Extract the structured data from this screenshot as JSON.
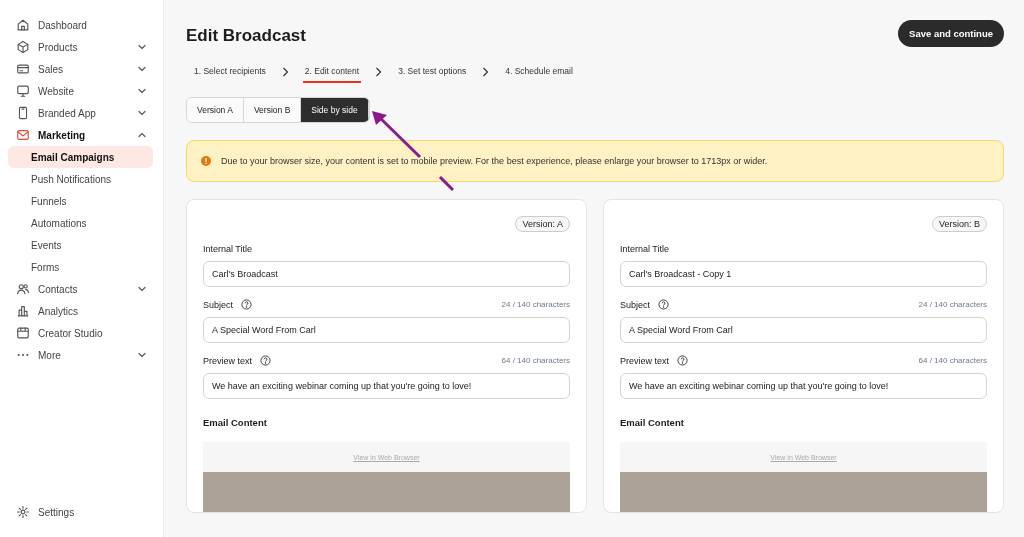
{
  "sidebar": {
    "items": [
      {
        "label": "Dashboard",
        "selected": false
      },
      {
        "label": "Products",
        "selected": false,
        "expanded": false
      },
      {
        "label": "Sales",
        "selected": false,
        "expanded": false
      },
      {
        "label": "Website",
        "selected": false,
        "expanded": false
      },
      {
        "label": "Branded App",
        "selected": false,
        "expanded": false
      },
      {
        "label": "Marketing",
        "selected": true,
        "expanded": true,
        "children": [
          {
            "label": "Email Campaigns",
            "selected": true
          },
          {
            "label": "Push Notifications",
            "selected": false
          },
          {
            "label": "Funnels",
            "selected": false
          },
          {
            "label": "Automations",
            "selected": false
          },
          {
            "label": "Events",
            "selected": false
          },
          {
            "label": "Forms",
            "selected": false
          }
        ]
      },
      {
        "label": "Contacts",
        "selected": false,
        "expanded": false
      },
      {
        "label": "Analytics",
        "selected": false
      },
      {
        "label": "Creator Studio",
        "selected": false
      },
      {
        "label": "More",
        "selected": false,
        "expanded": false
      }
    ],
    "settings": "Settings"
  },
  "page": {
    "title": "Edit Broadcast",
    "save_button": "Save and continue"
  },
  "steps": [
    {
      "label": "1. Select recipients",
      "selected": false
    },
    {
      "label": "2. Edit content",
      "selected": true
    },
    {
      "label": "3. Set test options",
      "selected": false
    },
    {
      "label": "4. Schedule email",
      "selected": false
    }
  ],
  "tabs": [
    {
      "label": "Version A",
      "selected": false
    },
    {
      "label": "Version B",
      "selected": false
    },
    {
      "label": "Side by side",
      "selected": true
    }
  ],
  "alert": {
    "text": "Due to your browser size, your content is set to mobile preview. For the best experience, please enlarge your browser to 1713px or wider."
  },
  "versions": [
    {
      "badge": "Version: A",
      "fields": [
        {
          "label": "Internal Title",
          "help": false,
          "value": "Carl's Broadcast"
        },
        {
          "label": "Subject",
          "help": true,
          "counter": "24 / 140 characters",
          "value": "A Special Word From Carl"
        },
        {
          "label": "Preview text",
          "help": true,
          "counter": "64 / 140 characters",
          "value": "We have an exciting webinar coming up that you're going to love!"
        }
      ],
      "section": "Email Content",
      "preview_link": "View in Web Browser"
    },
    {
      "badge": "Version: B",
      "fields": [
        {
          "label": "Internal Title",
          "help": false,
          "value": "Carl's Broadcast - Copy 1"
        },
        {
          "label": "Subject",
          "help": true,
          "counter": "24 / 140 characters",
          "value": "A Special Word From Carl"
        },
        {
          "label": "Preview text",
          "help": true,
          "counter": "64 / 140 characters",
          "value": "We have an exciting webinar coming up that you're going to love!"
        }
      ],
      "section": "Email Content",
      "preview_link": "View in Web Browser"
    }
  ]
}
